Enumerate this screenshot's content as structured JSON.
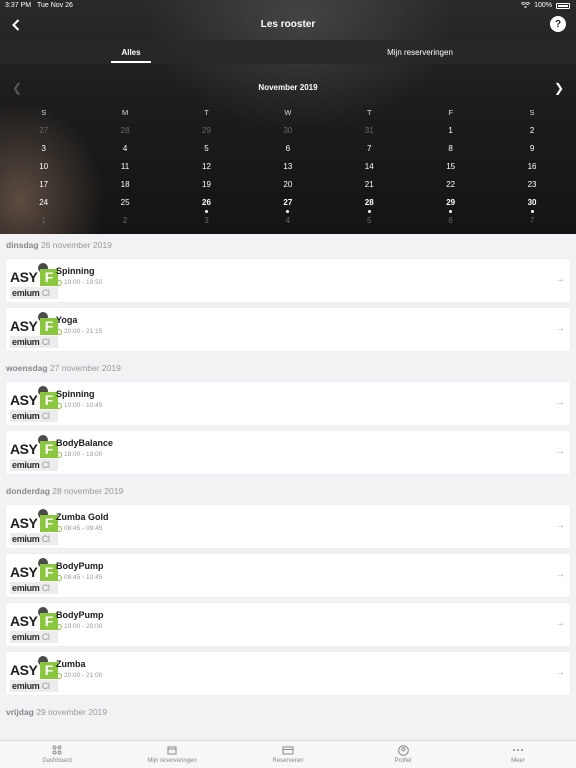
{
  "status": {
    "time": "3:37 PM",
    "date": "Tue Nov 26",
    "battery": "100%"
  },
  "nav": {
    "title": "Les rooster",
    "help": "?"
  },
  "tabs": [
    {
      "label": "Alles"
    },
    {
      "label": "Mijn reserveringen"
    }
  ],
  "calendar": {
    "month": "November 2019",
    "weekdays": [
      "S",
      "M",
      "T",
      "W",
      "T",
      "F",
      "S"
    ],
    "weeks": [
      [
        {
          "d": "27",
          "m": true
        },
        {
          "d": "28",
          "m": true
        },
        {
          "d": "29",
          "m": true
        },
        {
          "d": "30",
          "m": true
        },
        {
          "d": "31",
          "m": true
        },
        {
          "d": "1"
        },
        {
          "d": "2"
        }
      ],
      [
        {
          "d": "3"
        },
        {
          "d": "4"
        },
        {
          "d": "5"
        },
        {
          "d": "6"
        },
        {
          "d": "7"
        },
        {
          "d": "8"
        },
        {
          "d": "9"
        }
      ],
      [
        {
          "d": "10"
        },
        {
          "d": "11"
        },
        {
          "d": "12"
        },
        {
          "d": "13"
        },
        {
          "d": "14"
        },
        {
          "d": "15"
        },
        {
          "d": "16"
        }
      ],
      [
        {
          "d": "17"
        },
        {
          "d": "18"
        },
        {
          "d": "19"
        },
        {
          "d": "20"
        },
        {
          "d": "21"
        },
        {
          "d": "22"
        },
        {
          "d": "23"
        }
      ],
      [
        {
          "d": "24"
        },
        {
          "d": "25"
        },
        {
          "d": "26",
          "b": true,
          "dot": true
        },
        {
          "d": "27",
          "b": true,
          "dot": true
        },
        {
          "d": "28",
          "b": true,
          "dot": true
        },
        {
          "d": "29",
          "b": true,
          "dot": true
        },
        {
          "d": "30",
          "b": true,
          "dot": true
        }
      ],
      [
        {
          "d": "1",
          "m": true
        },
        {
          "d": "2",
          "m": true
        },
        {
          "d": "3",
          "m": true
        },
        {
          "d": "4",
          "m": true
        },
        {
          "d": "5",
          "m": true
        },
        {
          "d": "6",
          "m": true
        },
        {
          "d": "7",
          "m": true
        }
      ]
    ]
  },
  "logo": {
    "top": "ASY",
    "f": "F",
    "bottom": "emium",
    "bottom_tail": "Cl"
  },
  "schedule": [
    {
      "dayname": "dinsdag",
      "date": "26 november 2019",
      "classes": [
        {
          "title": "Spinning",
          "time": "19:00 - 19:50"
        },
        {
          "title": "Yoga",
          "time": "20:00 - 21:15"
        }
      ]
    },
    {
      "dayname": "woensdag",
      "date": "27 november 2019",
      "classes": [
        {
          "title": "Spinning",
          "time": "10:00 - 10:45"
        },
        {
          "title": "BodyBalance",
          "time": "18:00 - 19:00"
        }
      ]
    },
    {
      "dayname": "donderdag",
      "date": "28 november 2019",
      "classes": [
        {
          "title": "Zumba Gold",
          "time": "08:45 - 09:45"
        },
        {
          "title": "BodyPump",
          "time": "09:45 - 10:45"
        },
        {
          "title": "BodyPump",
          "time": "19:00 - 20:00"
        },
        {
          "title": "Zumba",
          "time": "20:00 - 21:00"
        }
      ]
    },
    {
      "dayname": "vrijdag",
      "date": "29 november 2019",
      "classes": []
    }
  ],
  "bottom_tabs": [
    {
      "label": "Dashboard",
      "icon": "grid-icon"
    },
    {
      "label": "Mijn reserveringen",
      "icon": "calendar-icon"
    },
    {
      "label": "Reserveren",
      "icon": "card-icon"
    },
    {
      "label": "Profiel",
      "icon": "profile-icon"
    },
    {
      "label": "Meer",
      "icon": "more-icon"
    }
  ],
  "colors": {
    "accent": "#8bc63f",
    "header_bg": "#1d1d1d",
    "list_bg": "#f2f2f4"
  }
}
